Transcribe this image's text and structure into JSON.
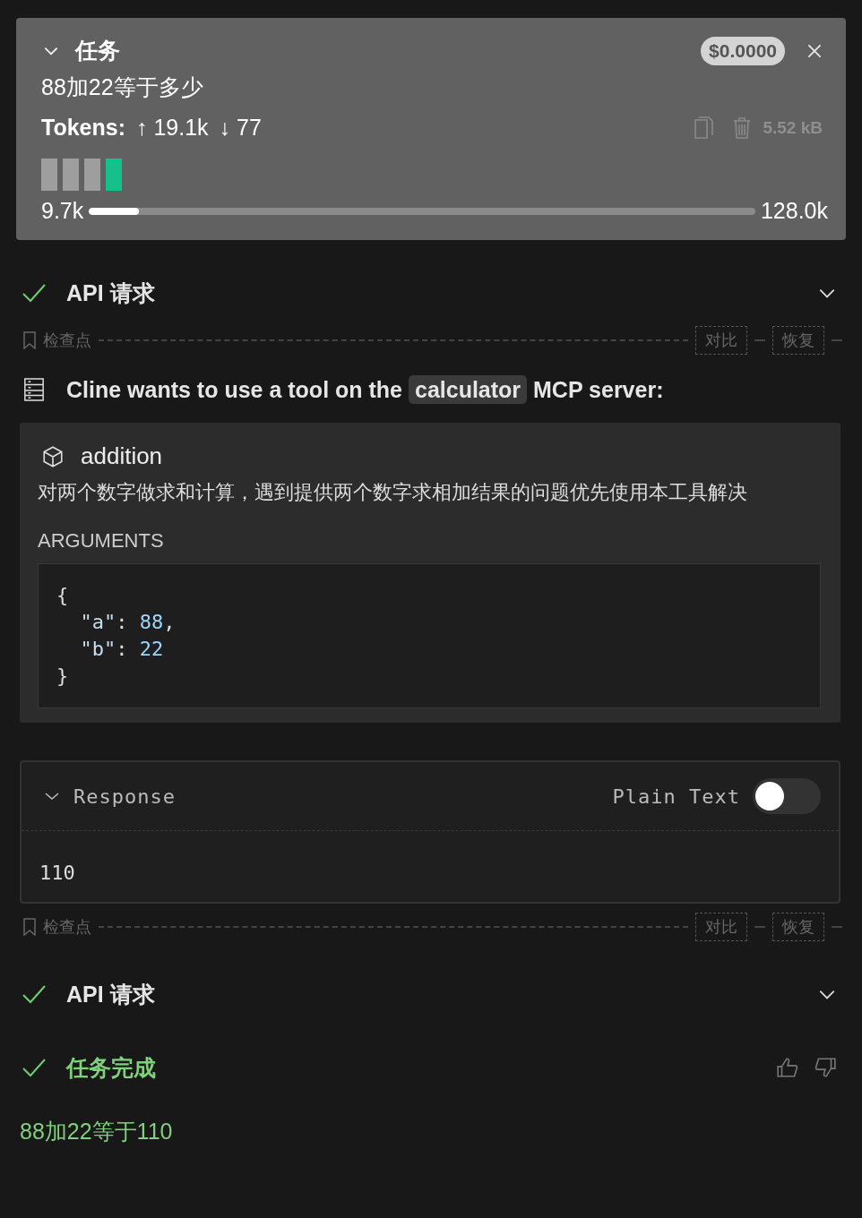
{
  "task": {
    "title": "任务",
    "expanded": true,
    "cost": "$0.0000",
    "question": "88加22等于多少",
    "tokens_label": "Tokens:",
    "tokens_up": "↑ 19.1k",
    "tokens_down": "↓ 77",
    "size": "5.52 kB",
    "blocks": [
      {
        "color": "#9e9e9e"
      },
      {
        "color": "#9e9e9e"
      },
      {
        "color": "#9e9e9e"
      },
      {
        "color": "#16c08a"
      }
    ],
    "context_used": "9.7k",
    "level": 0.075,
    "context_max": "128.0k"
  },
  "messages": [
    {
      "kind": "api",
      "title": "API 请求",
      "expanded": false
    },
    {
      "kind": "checkpoint",
      "label": "检查点",
      "buttons": [
        "对比",
        "恢复"
      ]
    },
    {
      "kind": "mcp",
      "prefix": "Cline wants to use a tool on the",
      "server": "calculator",
      "suffix": "MCP server:"
    },
    {
      "kind": "tool",
      "name": "addition",
      "description": "对两个数字做求和计算，遇到提供两个数字求相加结果的问题优先使用本工具解决",
      "args_label": "ARGUMENTS",
      "code": [
        [
          {
            "kind": "punct",
            "text": "{"
          }
        ],
        [
          {
            "kind": "key",
            "text": "  \"a\""
          },
          {
            "kind": "punct",
            "text": ": "
          },
          {
            "kind": "number",
            "text": "88"
          },
          {
            "kind": "punct",
            "text": ","
          }
        ],
        [
          {
            "kind": "key",
            "text": "  \"b\""
          },
          {
            "kind": "punct",
            "text": ": "
          },
          {
            "kind": "number",
            "text": "22"
          }
        ],
        [
          {
            "kind": "punct",
            "text": "}"
          }
        ]
      ]
    },
    {
      "kind": "response",
      "title": "Response",
      "expanded": true,
      "toggle_label": "Plain Text",
      "on": false,
      "body": "110"
    },
    {
      "kind": "checkpoint",
      "label": "检查点",
      "buttons": [
        "对比",
        "恢复"
      ]
    },
    {
      "kind": "api",
      "title": "API 请求",
      "expanded": false
    },
    {
      "kind": "completion",
      "title": "任务完成"
    },
    {
      "kind": "result",
      "text": "88加22等于110"
    }
  ]
}
